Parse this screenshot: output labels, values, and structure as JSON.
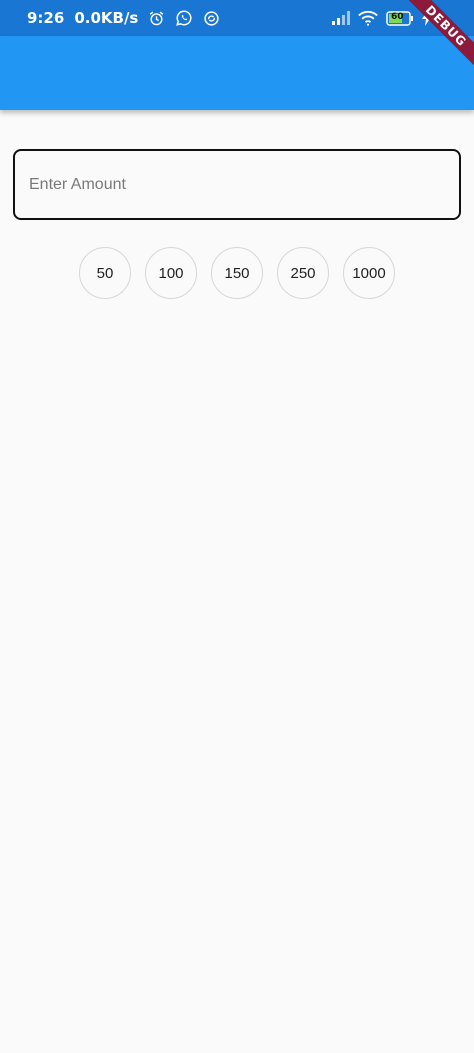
{
  "status_bar": {
    "time": "9:26",
    "network_speed": "0.0KB/s",
    "battery_level": "60",
    "left_icons": [
      "alarm-icon",
      "whatsapp-icon",
      "sync-icon"
    ],
    "right_icons": [
      "signal-icon",
      "wifi-icon",
      "battery-icon",
      "charging-icon"
    ]
  },
  "debug_banner": {
    "label": "DEBUG",
    "color": "#8b1a3b"
  },
  "app_bar": {
    "color": "#2196f3"
  },
  "amount_input": {
    "placeholder": "Enter Amount",
    "value": ""
  },
  "amount_chips": [
    {
      "label": "50"
    },
    {
      "label": "100"
    },
    {
      "label": "150"
    },
    {
      "label": "250"
    },
    {
      "label": "1000"
    }
  ]
}
